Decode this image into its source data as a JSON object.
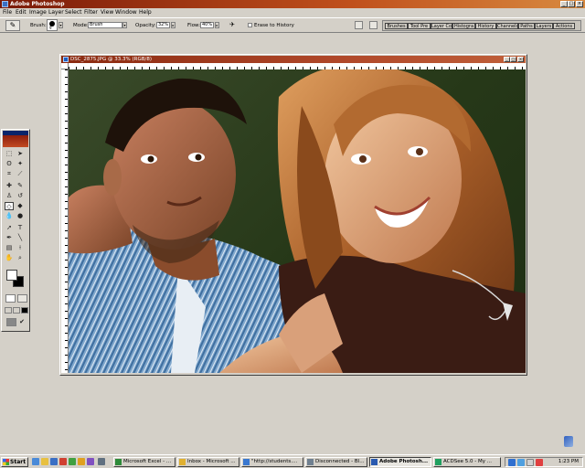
{
  "app": {
    "title": "Adobe Photoshop"
  },
  "menu": [
    "File",
    "Edit",
    "Image",
    "Layer",
    "Select",
    "Filter",
    "View",
    "Window",
    "Help"
  ],
  "options": {
    "brush_label": "Brush:",
    "brush_size": "9",
    "mode_label": "Mode:",
    "mode_value": "Brush",
    "opacity_label": "Opacity:",
    "opacity_value": "32%",
    "flow_label": "Flow:",
    "flow_value": "40%",
    "erase_history_label": "Erase to History"
  },
  "palette_tabs": [
    "Brushes",
    "Tool Pre",
    "Layer Co",
    "Histogra",
    "History",
    "Channels",
    "Paths",
    "Layers",
    "Actions"
  ],
  "document": {
    "title": "DSC_2875.JPG @ 33.3% (RGB/8)"
  },
  "taskbar": {
    "start_label": "Start",
    "tasks": [
      "Microsoft Excel - ...",
      "Inbox - Microsoft ...",
      "\"http://students....",
      "Disconnected - Bl...",
      "Adobe Photosh...",
      "ACDSee 5.0 - My ..."
    ],
    "active_task": 4,
    "clock": "1:23 PM"
  },
  "colors": {
    "title_start": "#7a1a08",
    "title_end": "#d88a40",
    "chrome": "#d4d0c8",
    "active_blue": "#0a246a"
  }
}
